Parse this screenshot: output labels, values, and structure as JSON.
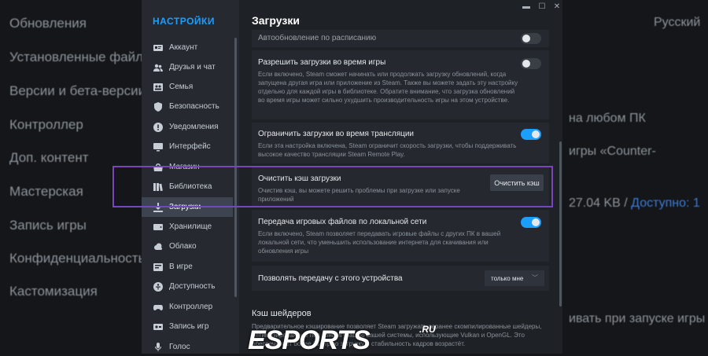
{
  "background": {
    "left_items": [
      "Обновления",
      "Установленные файлы",
      "Версии и бета-версии",
      "Контроллер",
      "Доп. контент",
      "Мастерская",
      "Запись игры",
      "Конфиденциальность",
      "Кастомизация"
    ],
    "right_texts": {
      "language": "Русский",
      "t1": "на любом ПК",
      "t2": "игры «Counter-",
      "t3": "27.04 KB /",
      "t3_link": "Доступно: 1",
      "t4": "ивать при запуске игры"
    }
  },
  "sidebar": {
    "title": "НАСТРОЙКИ",
    "items": [
      {
        "label": "Аккаунт",
        "icon": "account-card-icon"
      },
      {
        "label": "Друзья и чат",
        "icon": "friends-icon"
      },
      {
        "label": "Семья",
        "icon": "family-icon"
      },
      {
        "label": "Безопасность",
        "icon": "shield-icon"
      },
      {
        "label": "Уведомления",
        "icon": "notification-icon"
      },
      {
        "label": "Интерфейс",
        "icon": "monitor-icon"
      },
      {
        "label": "Магазин",
        "icon": "store-icon"
      },
      {
        "label": "Библиотека",
        "icon": "library-icon"
      },
      {
        "label": "Загрузки",
        "icon": "download-icon",
        "active": true
      },
      {
        "label": "Хранилище",
        "icon": "storage-icon"
      },
      {
        "label": "Облако",
        "icon": "cloud-icon"
      },
      {
        "label": "В игре",
        "icon": "in-game-icon"
      },
      {
        "label": "Доступность",
        "icon": "accessibility-icon"
      },
      {
        "label": "Контроллер",
        "icon": "controller-icon"
      },
      {
        "label": "Запись игр",
        "icon": "record-icon"
      },
      {
        "label": "Голос",
        "icon": "microphone-icon"
      }
    ]
  },
  "window": {
    "minimize": "▬",
    "maximize": "☐",
    "close": "✕"
  },
  "page": {
    "title": "Загрузки",
    "settings": {
      "auto_update": {
        "title": "Автообновление по расписанию",
        "enabled": false
      },
      "allow_in_game": {
        "title": "Разрешить загрузки во время игры",
        "desc": "Если включено, Steam сможет начинать или продолжать загрузку обновлений, когда запущена другая игра или приложение из Steam. Также вы можете задать эту настройку отдельно для каждой игры в библиотеке. Обратите внимание, что загрузка обновлений во время игры может сильно ухудшить производительность игры на этом устройстве.",
        "enabled": false
      },
      "limit_broadcast": {
        "title": "Ограничить загрузки во время трансляции",
        "desc": "Если эта настройка включена, Steam ограничит скорость загрузки, чтобы поддерживать высокое качество трансляции Steam Remote Play.",
        "enabled": true
      },
      "clear_cache": {
        "title": "Очистить кэш загрузки",
        "desc": "Очистив кэш, вы можете решить проблемы при загрузке или запуске приложений",
        "button": "Очистить кэш"
      },
      "lan_transfer": {
        "title": "Передача игровых файлов по локальной сети",
        "desc": "Если включено, Steam позволяет передавать игровые файлы с других ПК в вашей локальной сети, что уменьшить использование интернета для скачивания или обновления игры",
        "enabled": true
      },
      "allow_transfer": {
        "title": "Позволять передачу с этого устройства",
        "value": "только мне"
      }
    },
    "shader_section": {
      "title": "Кэш шейдеров",
      "desc": "Предварительное кэширование позволяет Steam загружать заранее скомпилированные шейдеры, оптимизированные под конфигурацию вашей системы, использующие Vulkan и OpenGL. Это обеспечивает более быструю загрузку и стабильность кадров возрастёт."
    }
  },
  "watermark": {
    "text": "ESPORTS",
    "suffix": ".RU"
  }
}
